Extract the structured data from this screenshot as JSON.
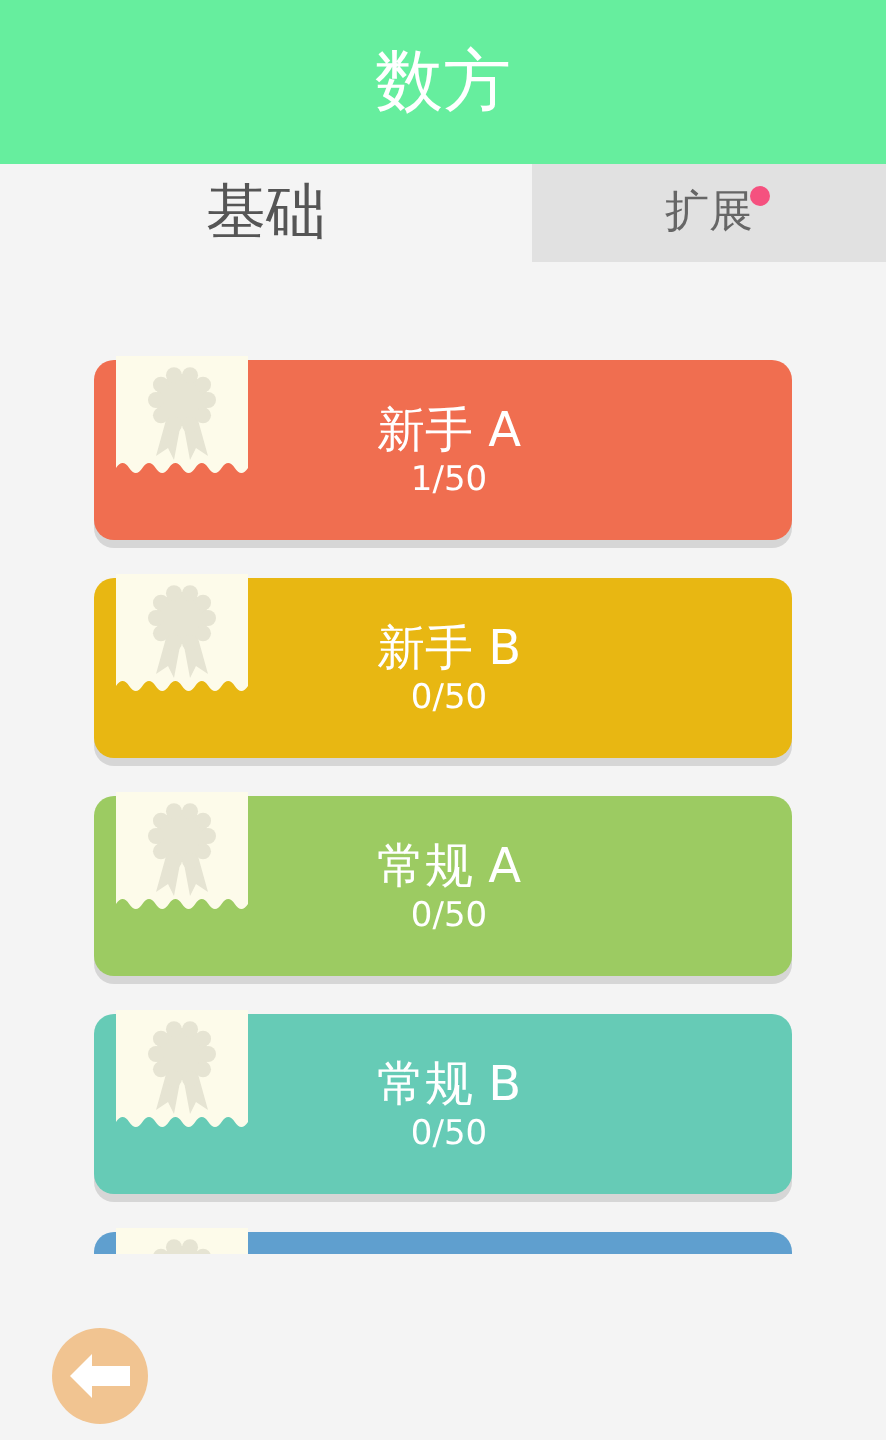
{
  "header": {
    "title": "数方"
  },
  "tabs": [
    {
      "label": "基础",
      "selected": true,
      "notification": false
    },
    {
      "label": "扩展",
      "selected": false,
      "notification": true
    }
  ],
  "levels": [
    {
      "title": "新手 A",
      "progress": "1/50",
      "color": "#f06e50"
    },
    {
      "title": "新手 B",
      "progress": "0/50",
      "color": "#e8b712"
    },
    {
      "title": "常规 A",
      "progress": "0/50",
      "color": "#9ccb62"
    },
    {
      "title": "常规 B",
      "progress": "0/50",
      "color": "#66cbb6"
    },
    {
      "color": "#5f9fcf"
    }
  ],
  "back_button": {
    "kind": "back"
  }
}
